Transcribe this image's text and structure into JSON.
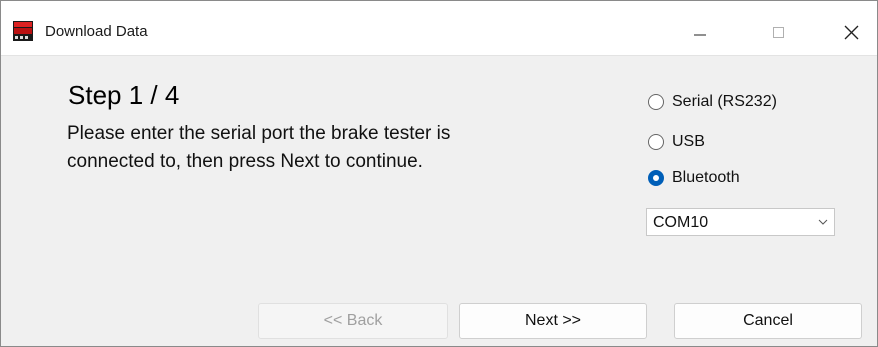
{
  "window": {
    "title": "Download Data",
    "controls": {
      "minimize_icon": "minimize-icon",
      "maximize_icon": "maximize-icon",
      "close_icon": "close-icon"
    }
  },
  "content": {
    "step_title": "Step 1 / 4",
    "instructions_line1": "Please enter the serial port the brake tester is",
    "instructions_line2": "connected to, then press Next to continue."
  },
  "connection": {
    "options": [
      {
        "label": "Serial (RS232)",
        "selected": false
      },
      {
        "label": "USB",
        "selected": false
      },
      {
        "label": "Bluetooth",
        "selected": true
      }
    ],
    "port_selected": "COM10"
  },
  "buttons": {
    "back": "<< Back",
    "next": "Next >>",
    "cancel": "Cancel"
  },
  "colors": {
    "accent": "#005fb8",
    "background": "#f0f0f0",
    "titlebar": "#ffffff"
  }
}
